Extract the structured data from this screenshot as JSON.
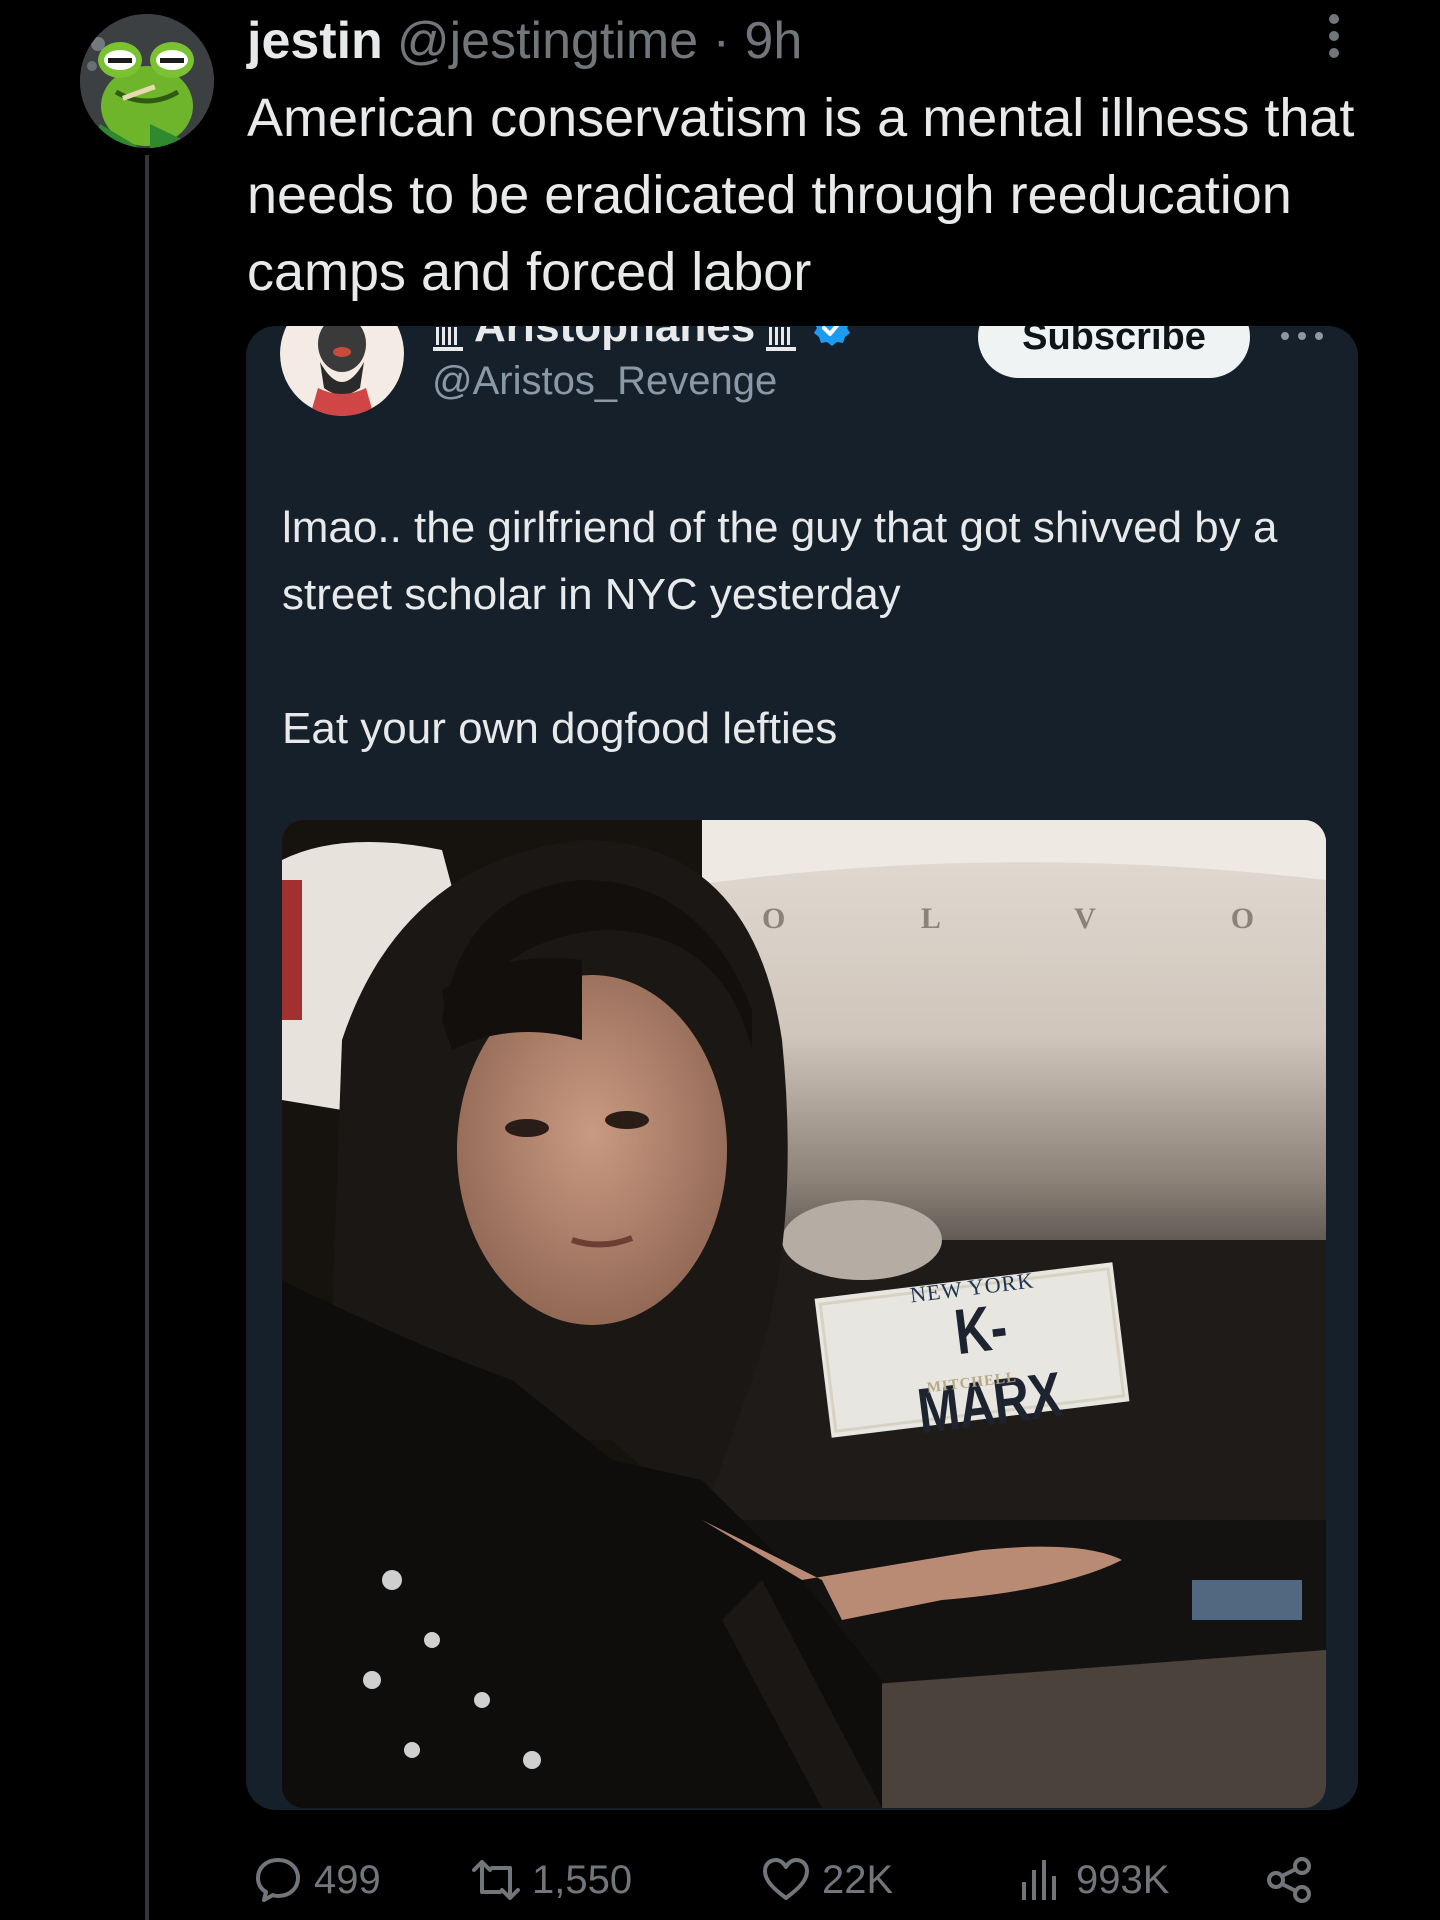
{
  "tweet": {
    "author_name": "jestin",
    "author_handle": "@jestingtime",
    "separator": "·",
    "time": "9h",
    "text": "American conservatism is a mental illness that needs to be eradicated through reeducation camps and forced labor",
    "avatar_icon": "frog-avatar-icon",
    "more_icon": "more-vertical-icon"
  },
  "quote": {
    "author_name": "Aristophanes",
    "author_handle": "@Aristos_Revenge",
    "subscribe_label": "Subscribe",
    "paragraph_1": "lmao.. the girlfriend of the guy that got shivved by a street scholar in NYC yesterday",
    "paragraph_2": "Eat your own dogfood lefties",
    "avatar_icon": "aristophanes-avatar-icon",
    "verified_icon": "verified-badge-icon",
    "pillar_icon": "greek-pillar-icon"
  },
  "photo": {
    "plate_state": "NEW YORK",
    "plate_text": "K-MARX",
    "plate_frame": "MITCHELL",
    "car_badge": "O L V O"
  },
  "actions": {
    "replies": "499",
    "reposts": "1,550",
    "likes": "22K",
    "views": "993K"
  },
  "colors": {
    "background": "#000000",
    "card": "#15202b",
    "text": "#e7e9ea",
    "muted": "#71767b",
    "verified": "#1d9bf0"
  }
}
